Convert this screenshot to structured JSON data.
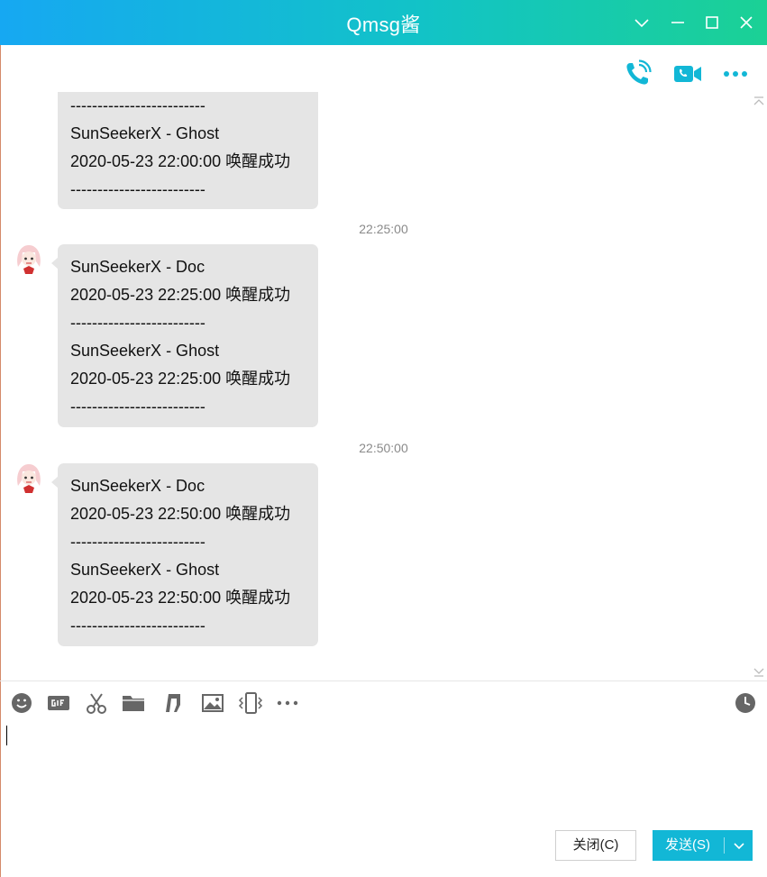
{
  "window": {
    "title": "Qmsg酱",
    "accent_gradient": [
      "#16a8f2",
      "#1bd195"
    ]
  },
  "chat_toolbar": {
    "icons": [
      "voice-call-icon",
      "video-call-icon",
      "more-icon"
    ]
  },
  "messages": {
    "m0": {
      "lines": [
        "-------------------------",
        "SunSeekerX - Ghost",
        "2020-05-23 22:00:00 唤醒成功",
        "-------------------------"
      ]
    },
    "t1": "22:25:00",
    "m1": {
      "lines": [
        "SunSeekerX - Doc",
        "2020-05-23 22:25:00 唤醒成功",
        "-------------------------",
        "SunSeekerX - Ghost",
        "2020-05-23 22:25:00 唤醒成功",
        "-------------------------"
      ]
    },
    "t2": "22:50:00",
    "m2": {
      "lines": [
        "SunSeekerX - Doc",
        "2020-05-23 22:50:00 唤醒成功",
        "-------------------------",
        "SunSeekerX - Ghost",
        "2020-05-23 22:50:00 唤醒成功",
        "-------------------------"
      ]
    }
  },
  "input_toolbar": {
    "icons": [
      "emoji-icon",
      "gif-icon",
      "screenshot-icon",
      "folder-icon",
      "music-icon",
      "image-icon",
      "shake-icon",
      "more-icon",
      "history-icon"
    ]
  },
  "input": {
    "value": ""
  },
  "actions": {
    "close_label": "关闭(C)",
    "send_label": "发送(S)"
  },
  "colors": {
    "bubble": "#e5e5e5",
    "send_button": "#12b7d6",
    "icon_teal": "#12b7d6",
    "icon_gray": "#666666"
  }
}
